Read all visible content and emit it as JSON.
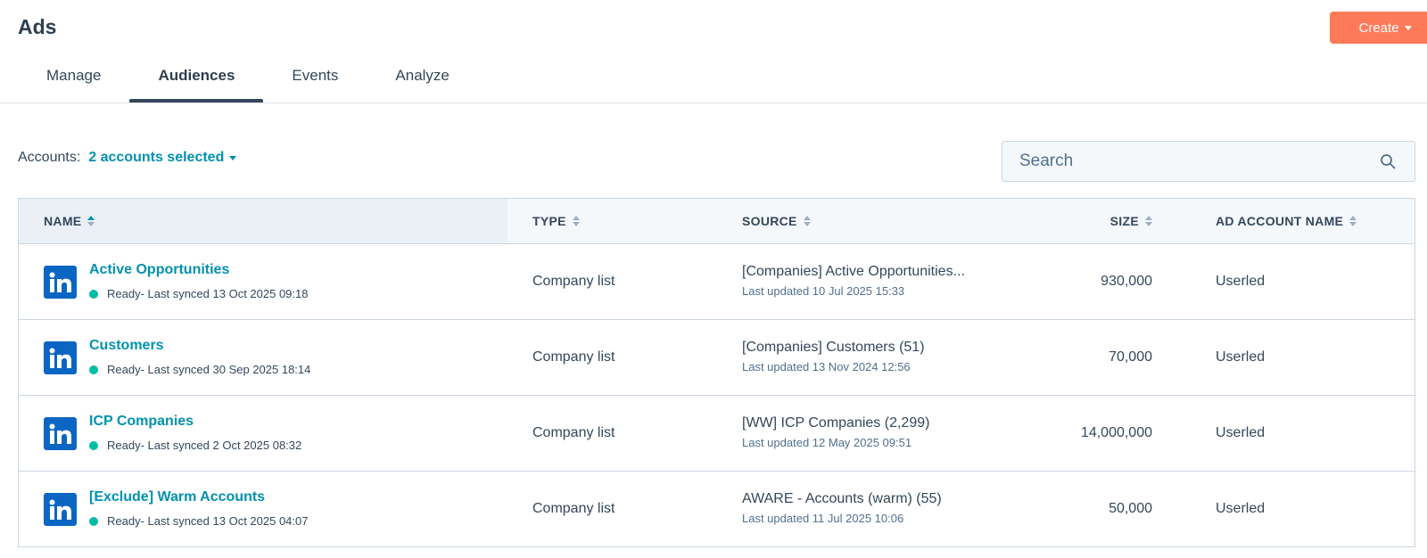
{
  "header": {
    "title": "Ads",
    "create_label": "Create"
  },
  "tabs": [
    {
      "label": "Manage",
      "active": false
    },
    {
      "label": "Audiences",
      "active": true
    },
    {
      "label": "Events",
      "active": false
    },
    {
      "label": "Analyze",
      "active": false
    }
  ],
  "filters": {
    "accounts_label": "Accounts:",
    "accounts_value": "2 accounts selected"
  },
  "search": {
    "placeholder": "Search"
  },
  "table": {
    "columns": {
      "name": "NAME",
      "type": "TYPE",
      "source": "SOURCE",
      "size": "SIZE",
      "account": "AD ACCOUNT NAME"
    },
    "rows": [
      {
        "icon": "linkedin-icon",
        "name": "Active Opportunities",
        "status": "Ready- Last synced 13 Oct 2025 09:18",
        "type": "Company list",
        "source": "[Companies] Active Opportunities...",
        "source_updated": "Last updated 10 Jul 2025 15:33",
        "size": "930,000",
        "account": "Userled"
      },
      {
        "icon": "linkedin-icon",
        "name": "Customers",
        "status": "Ready- Last synced 30 Sep 2025 18:14",
        "type": "Company list",
        "source": "[Companies] Customers (51)",
        "source_updated": "Last updated 13 Nov 2024 12:56",
        "size": "70,000",
        "account": "Userled"
      },
      {
        "icon": "linkedin-icon",
        "name": "ICP Companies",
        "status": "Ready- Last synced 2 Oct 2025 08:32",
        "type": "Company list",
        "source": "[WW] ICP Companies (2,299)",
        "source_updated": "Last updated 12 May 2025 09:51",
        "size": "14,000,000",
        "account": "Userled"
      },
      {
        "icon": "linkedin-icon",
        "name": "[Exclude] Warm Accounts",
        "status": "Ready- Last synced 13 Oct 2025 04:07",
        "type": "Company list",
        "source": "AWARE - Accounts (warm) (55)",
        "source_updated": "Last updated 11 Jul 2025 10:06",
        "size": "50,000",
        "account": "Userled"
      }
    ]
  },
  "colors": {
    "accent": "#ff7a59",
    "link": "#0091ae",
    "status_ready": "#00bda5",
    "linkedin": "#0a66c2"
  }
}
